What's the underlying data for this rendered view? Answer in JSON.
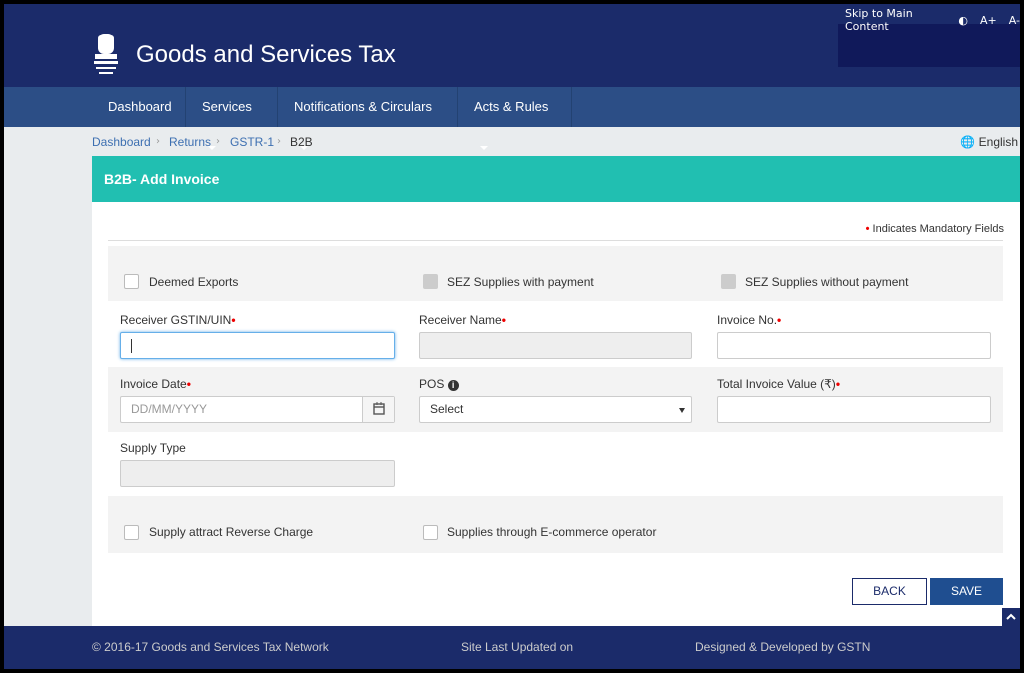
{
  "header": {
    "skip_link": "Skip to Main Content",
    "contrast_icon": "contrast-icon",
    "font_increase": "A+",
    "font_decrease": "A-",
    "title": "Goods and Services Tax"
  },
  "nav": [
    {
      "label": "Dashboard"
    },
    {
      "label": "Services"
    },
    {
      "label": "Notifications & Circulars"
    },
    {
      "label": "Acts & Rules"
    }
  ],
  "breadcrumb": [
    "Dashboard",
    "Returns",
    "GSTR-1",
    "B2B"
  ],
  "language": "English",
  "form": {
    "title": "B2B- Add Invoice",
    "mandatory_note": "Indicates Mandatory Fields",
    "mandatory_marker": "•",
    "checkboxes_top": [
      "Deemed Exports",
      "SEZ Supplies with payment",
      "SEZ Supplies without payment"
    ],
    "receiver_gstin_label": "Receiver GSTIN/UIN",
    "receiver_gstin_value": "",
    "receiver_name_label": "Receiver Name",
    "invoice_no_label": "Invoice No.",
    "invoice_date_label": "Invoice Date",
    "invoice_date_placeholder": "DD/MM/YYYY",
    "pos_label": "POS",
    "pos_selected": "Select",
    "total_value_label": "Total Invoice Value (₹)",
    "supply_type_label": "Supply Type",
    "checkboxes_bottom": [
      "Supply attract Reverse Charge",
      "Supplies through E-commerce operator"
    ],
    "back_label": "BACK",
    "save_label": "SAVE"
  },
  "footer": {
    "copyright": "© 2016-17 Goods and Services Tax Network",
    "updated": "Site Last Updated on",
    "designed": "Designed & Developed by GSTN"
  },
  "colors": {
    "header": "#1b2b6a",
    "nav": "#2c4e86",
    "panel_head": "#21bfb1",
    "save": "#1f4e90"
  }
}
